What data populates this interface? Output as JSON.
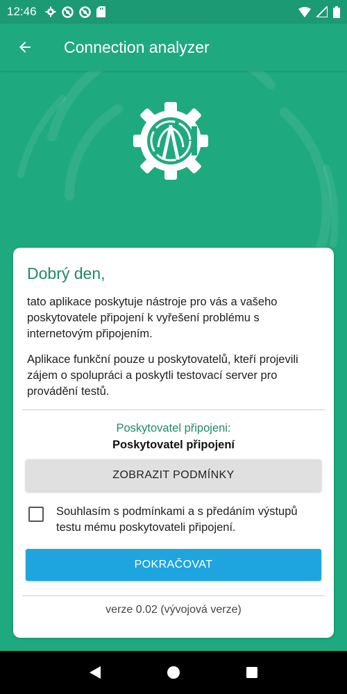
{
  "status_bar": {
    "time": "12:46",
    "left_icons": [
      "gear-icon",
      "no-entry-icon",
      "no-entry-icon",
      "sd-card-icon"
    ],
    "right_icons": [
      "wifi-icon",
      "signal-icon",
      "battery-icon"
    ]
  },
  "app_bar": {
    "title": "Connection analyzer",
    "back_icon": "arrow-left-icon"
  },
  "hero": {
    "logo_icon": "gear-antenna-logo"
  },
  "card": {
    "greeting": "Dobrý den,",
    "paragraph_1": "tato aplikace poskytuje nástroje pro vás a vašeho poskytovatele připojení k vyřešení problému s internetovým připojením.",
    "paragraph_2": "Aplikace funkční pouze u poskytovatelů, kteří projevili zájem o spolupráci a poskytli testovací server pro provádění testů.",
    "provider_label": "Poskytovatel připojeni:",
    "provider_name": "Poskytovatel připojení",
    "terms_button": "ZOBRAZIT PODMÍNKY",
    "agree_text": "Souhlasím s podmínkami a s předáním výstupů testu mému poskytovateli připojení.",
    "agree_checked": false,
    "continue_button": "POKRAČOVAT",
    "version": "verze 0.02 (vývojová verze)"
  },
  "nav_bar": {
    "icons": [
      "back-triangle-icon",
      "home-circle-icon",
      "recents-square-icon"
    ]
  },
  "colors": {
    "primary": "#1fa97f",
    "status_bar": "#1c9a74",
    "accent_text": "#1e8a68",
    "continue_button": "#1ea5df",
    "terms_button": "#e0e0e0"
  }
}
